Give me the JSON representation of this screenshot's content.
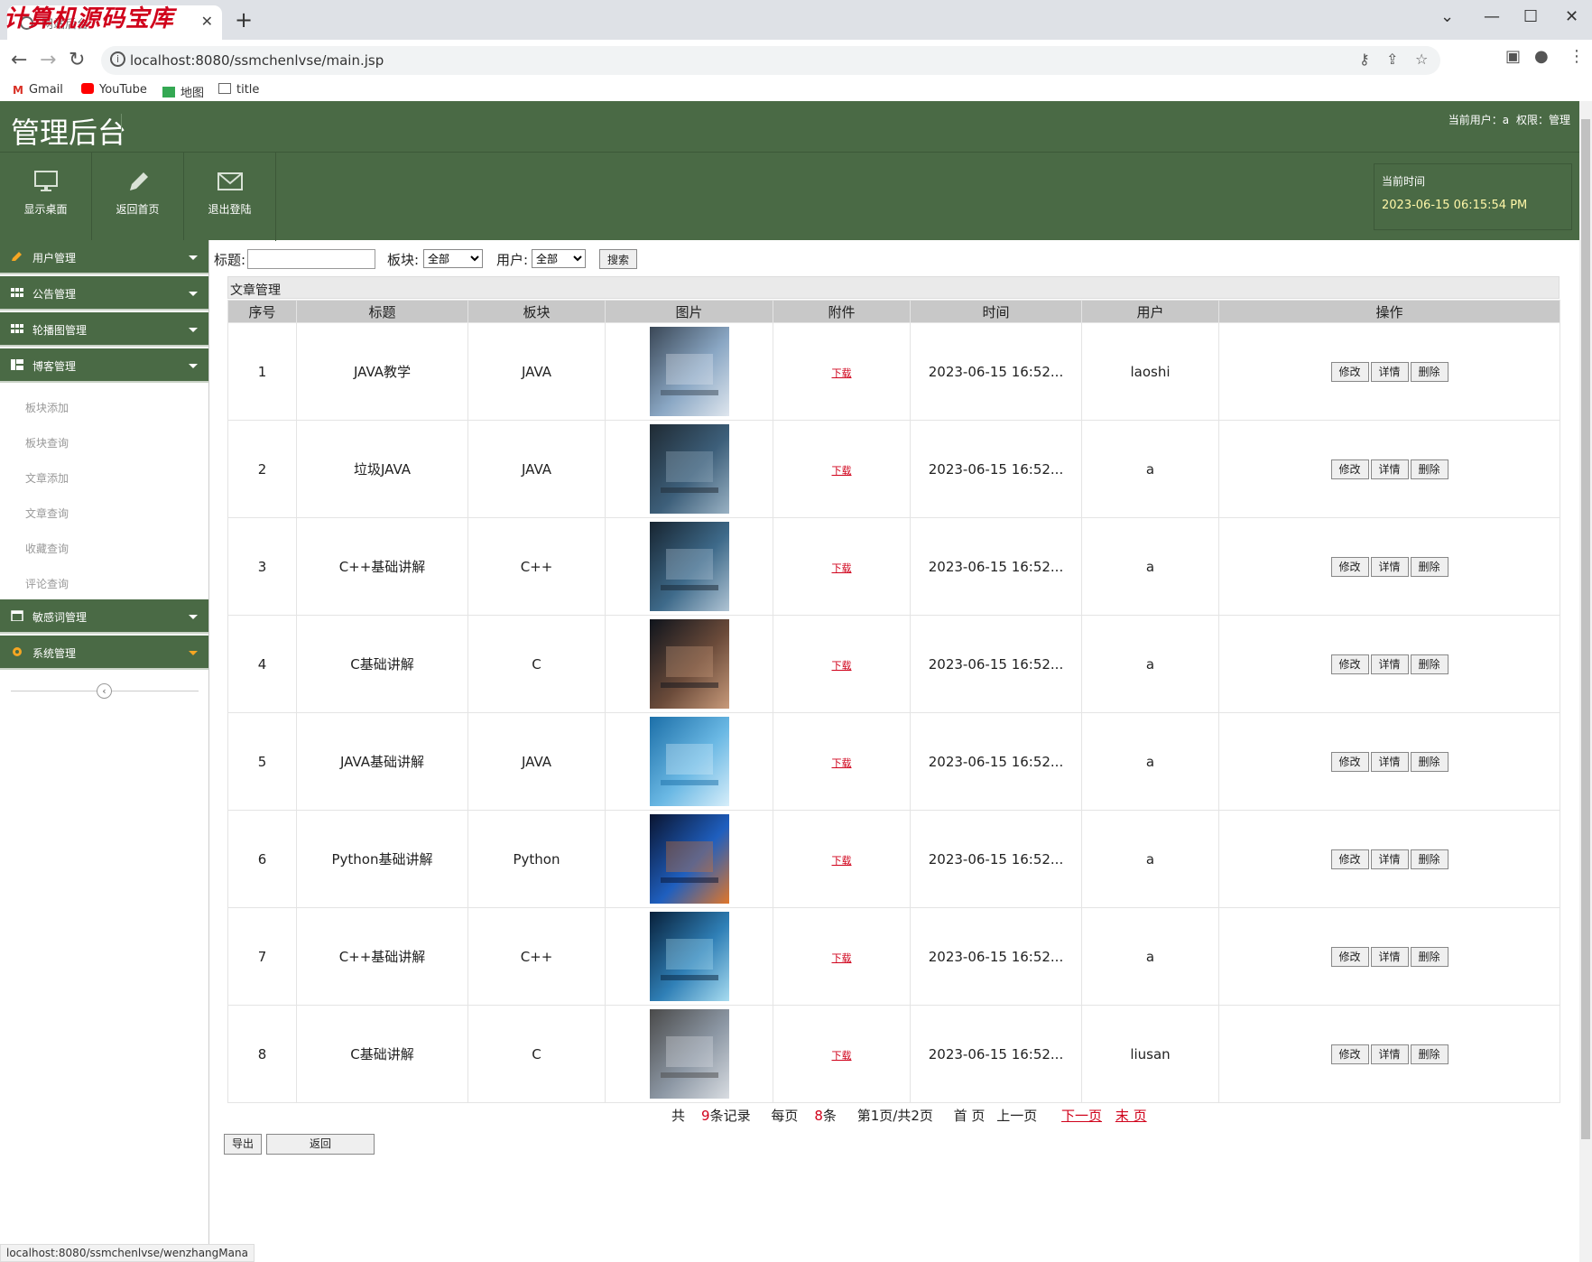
{
  "browser": {
    "watermark": "计算机源码宝库",
    "tab_title": "网站后台",
    "url": "localhost:8080/ssmchenlvse/main.jsp",
    "bookmarks": [
      "Gmail",
      "YouTube",
      "地图",
      "title"
    ],
    "status_url": "localhost:8080/ssmchenlvse/wenzhangMana"
  },
  "header": {
    "title": "管理后台",
    "current_user": "当前用户：a",
    "permission": "权限：管理"
  },
  "toolbar": {
    "items": [
      "显示桌面",
      "返回首页",
      "退出登陆"
    ],
    "time_label": "当前时间",
    "time_value": "2023-06-15 06:15:54 PM"
  },
  "sidebar": {
    "menus": [
      "用户管理",
      "公告管理",
      "轮播图管理",
      "博客管理",
      "敏感词管理",
      "系统管理"
    ],
    "blog_sub": [
      "板块添加",
      "板块查询",
      "文章添加",
      "文章查询",
      "收藏查询",
      "评论查询"
    ]
  },
  "filter": {
    "title_label": "标题:",
    "board_label": "板块:",
    "board_value": "全部",
    "user_label": "用户:",
    "user_value": "全部",
    "search_button": "搜索"
  },
  "panel_title": "文章管理",
  "table": {
    "columns": [
      "序号",
      "标题",
      "板块",
      "图片",
      "附件",
      "时间",
      "用户",
      "操作"
    ],
    "download_label": "下载",
    "actions": [
      "修改",
      "详情",
      "删除"
    ],
    "rows": [
      {
        "no": "1",
        "title": "JAVA教学",
        "board": "JAVA",
        "time": "2023-06-15 16:52...",
        "user": "laoshi"
      },
      {
        "no": "2",
        "title": "垃圾JAVA",
        "board": "JAVA",
        "time": "2023-06-15 16:52...",
        "user": "a"
      },
      {
        "no": "3",
        "title": "C++基础讲解",
        "board": "C++",
        "time": "2023-06-15 16:52...",
        "user": "a"
      },
      {
        "no": "4",
        "title": "C基础讲解",
        "board": "C",
        "time": "2023-06-15 16:52...",
        "user": "a"
      },
      {
        "no": "5",
        "title": "JAVA基础讲解",
        "board": "JAVA",
        "time": "2023-06-15 16:52...",
        "user": "a"
      },
      {
        "no": "6",
        "title": "Python基础讲解",
        "board": "Python",
        "time": "2023-06-15 16:52...",
        "user": "a"
      },
      {
        "no": "7",
        "title": "C++基础讲解",
        "board": "C++",
        "time": "2023-06-15 16:52...",
        "user": "a"
      },
      {
        "no": "8",
        "title": "C基础讲解",
        "board": "C",
        "time": "2023-06-15 16:52...",
        "user": "liusan"
      }
    ]
  },
  "pager": {
    "total_pre": "共",
    "total_num": "9",
    "total_post": "条记录",
    "per_pre": "每页",
    "per_num": "8",
    "per_post": "条",
    "page_info": "第1页/共2页",
    "first": "首 页",
    "prev": "上一页",
    "next": "下一页",
    "last": "末 页"
  },
  "bottom": {
    "export_button": "导出",
    "back_button": "返回"
  },
  "colors": {
    "header_green": "#4a6a45",
    "link_red": "#d0021b"
  }
}
